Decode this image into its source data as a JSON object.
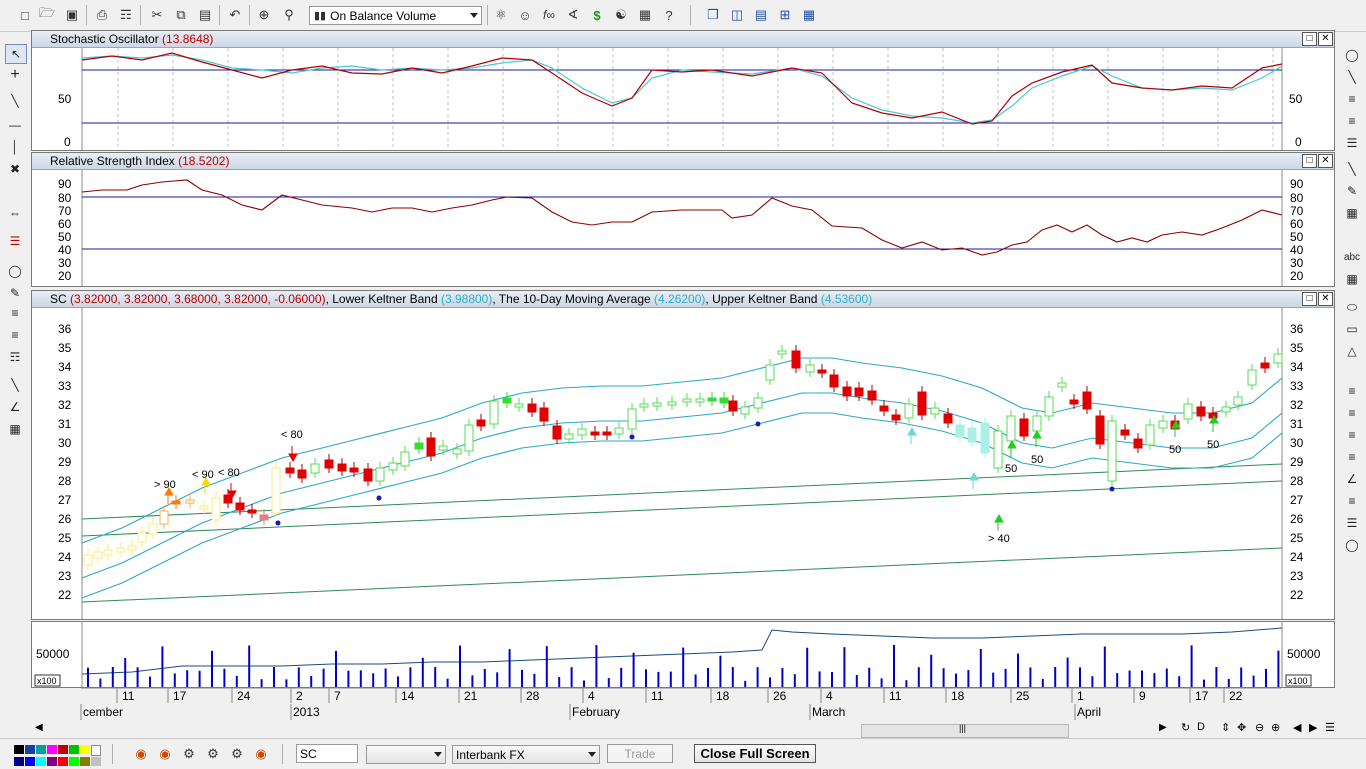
{
  "toolbar": {
    "indicator_combo": "On Balance Volume",
    "dollar_icon": "$",
    "fx_icon": "f∞"
  },
  "panels": {
    "stochastic": {
      "title": "Stochastic Oscillator",
      "value": "(13.8648)",
      "ticks": [
        "50",
        "0"
      ]
    },
    "rsi": {
      "title": "Relative Strength Index",
      "value": "(18.5202)",
      "ticks": [
        "90",
        "80",
        "70",
        "60",
        "50",
        "40",
        "30",
        "20"
      ]
    },
    "price": {
      "title_prefix": "SC",
      "ohlc": "(3.82000, 3.82000, 3.68000, 3.82000, -0.06000)",
      "band1_name": ", Lower Keltner Band",
      "band1_value": "(3.98800)",
      "band2_name": ", The 10-Day Moving Average",
      "band2_value": "(4.26200)",
      "band3_name": ", Upper Keltner Band",
      "band3_value": "(4.53600)",
      "ticks": [
        "36",
        "35",
        "34",
        "33",
        "32",
        "31",
        "30",
        "29",
        "28",
        "27",
        "26",
        "25",
        "24",
        "23",
        "22"
      ],
      "annotations": [
        "> 90",
        "< 90",
        "< 80",
        "< 80",
        "50",
        "50",
        "> 40",
        "50",
        "50"
      ]
    },
    "volume": {
      "tick": "50000",
      "scale": "x100"
    }
  },
  "xaxis": {
    "days": [
      "11",
      "17",
      "24",
      "2",
      "7",
      "14",
      "21",
      "28",
      "4",
      "11",
      "18",
      "26",
      "4",
      "11",
      "18",
      "25",
      "1",
      "9",
      "17",
      "22"
    ],
    "months": [
      "cember",
      "2013",
      "February",
      "March",
      "April"
    ]
  },
  "colors": {
    "up": "#33dd33",
    "down": "#e00000",
    "band": "#2aa8c8",
    "osc_red": "#b00000",
    "osc_cyan": "#48c8d8",
    "volume": "#0000c8"
  },
  "status": {
    "symbol": "SC",
    "feed": "Interbank FX",
    "trade_label": "Trade",
    "fullscreen_label": "Close Full Screen"
  }
}
